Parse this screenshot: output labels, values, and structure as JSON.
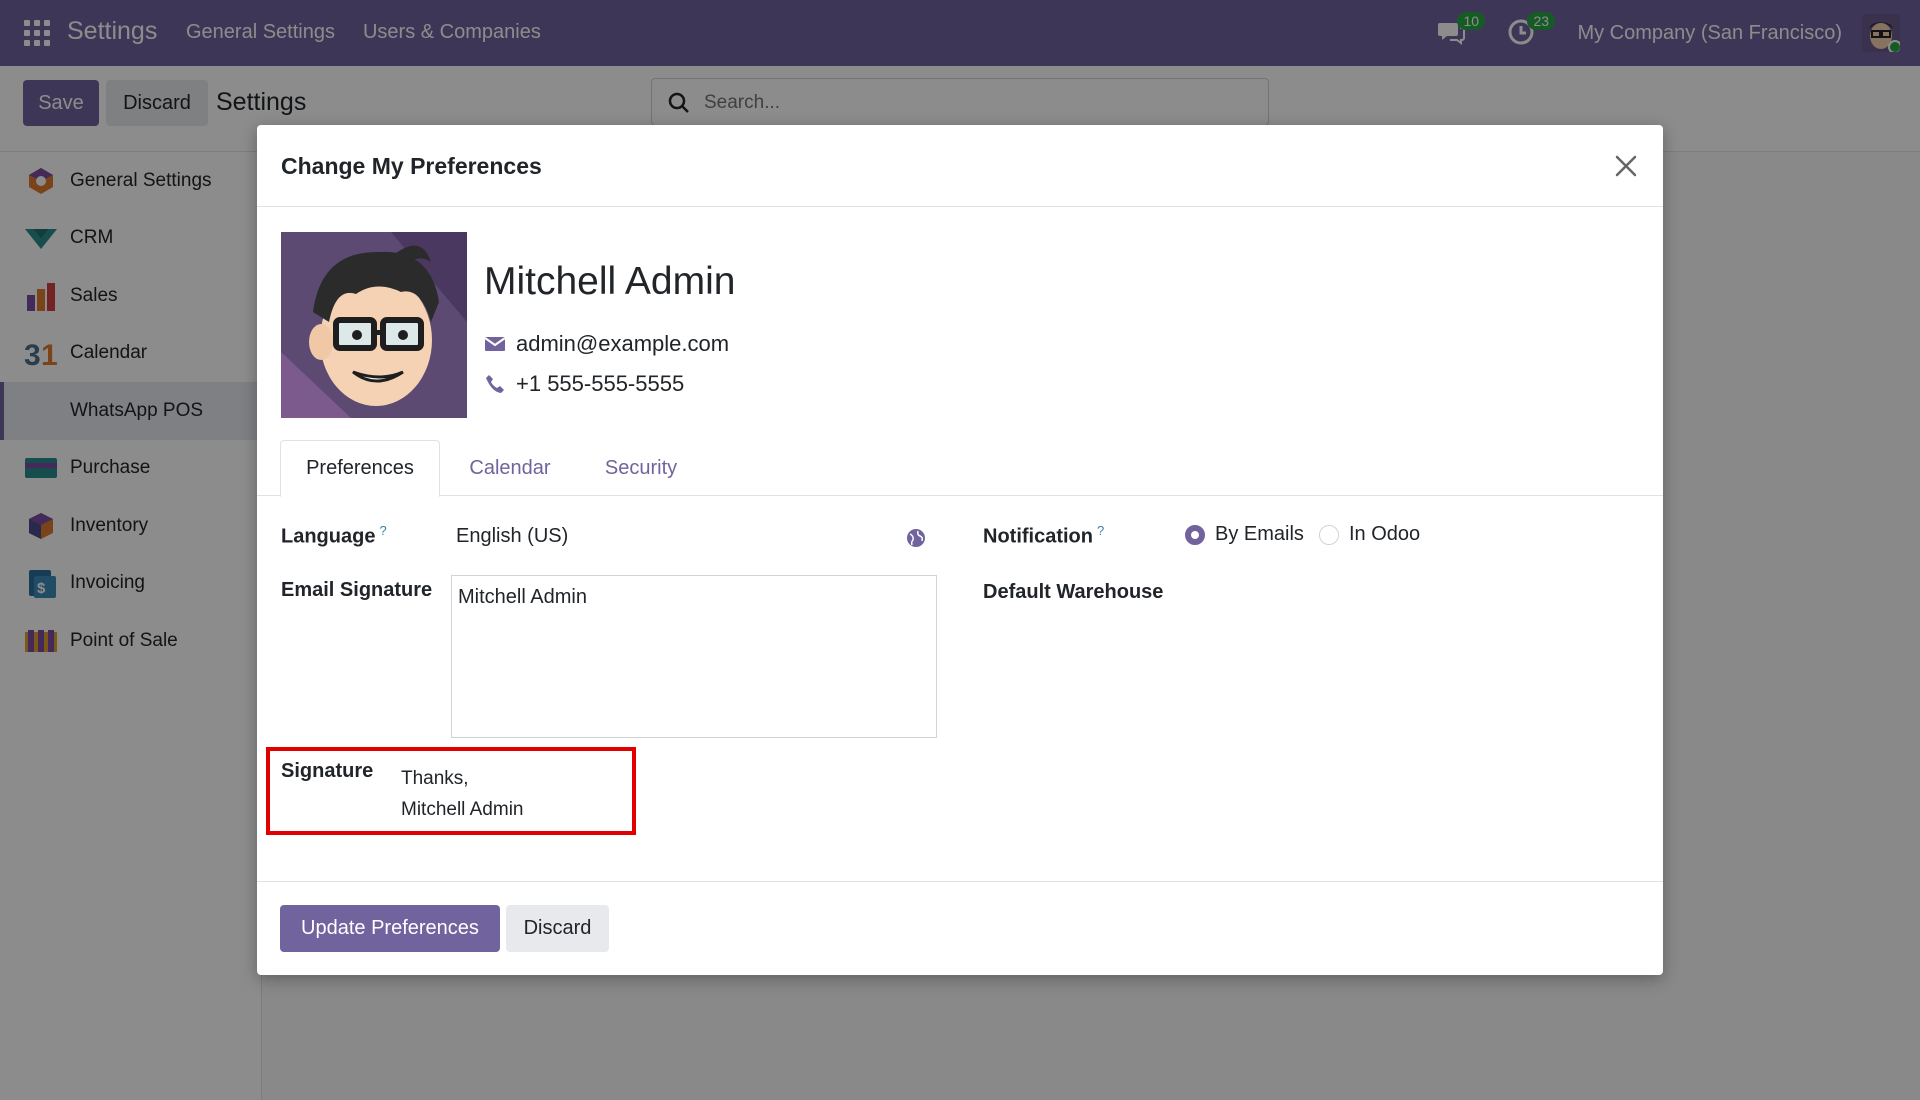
{
  "navbar": {
    "brand": "Settings",
    "menu": [
      "General Settings",
      "Users & Companies"
    ],
    "messages_count": "10",
    "activities_count": "23",
    "company": "My Company (San Francisco)"
  },
  "control": {
    "save_label": "Save",
    "discard_label": "Discard",
    "title": "Settings",
    "search_placeholder": "Search..."
  },
  "sidebar": {
    "items": [
      {
        "label": "General Settings",
        "icon": "general-settings-icon"
      },
      {
        "label": "CRM",
        "icon": "crm-icon"
      },
      {
        "label": "Sales",
        "icon": "sales-icon"
      },
      {
        "label": "Calendar",
        "icon": "calendar-icon"
      },
      {
        "label": "WhatsApp POS",
        "icon": "whatsapp-icon",
        "active": true
      },
      {
        "label": "Purchase",
        "icon": "purchase-icon"
      },
      {
        "label": "Inventory",
        "icon": "inventory-icon"
      },
      {
        "label": "Invoicing",
        "icon": "invoicing-icon"
      },
      {
        "label": "Point of Sale",
        "icon": "pos-icon"
      }
    ]
  },
  "modal": {
    "title": "Change My Preferences",
    "user": {
      "name": "Mitchell Admin",
      "email": "admin@example.com",
      "phone": "+1 555-555-5555"
    },
    "tabs": [
      "Preferences",
      "Calendar",
      "Security"
    ],
    "fields": {
      "language_label": "Language",
      "language_help": "?",
      "language_value": "English (US)",
      "email_signature_label": "Email Signature",
      "email_signature_value": "Mitchell Admin",
      "notification_label": "Notification",
      "notification_help": "?",
      "notification_options": [
        "By Emails",
        "In Odoo"
      ],
      "notification_selected": "By Emails",
      "default_warehouse_label": "Default Warehouse",
      "signature_label": "Signature",
      "signature_line1": "Thanks,",
      "signature_line2": "Mitchell Admin"
    },
    "footer": {
      "update_label": "Update Preferences",
      "discard_label": "Discard"
    }
  },
  "colors": {
    "primary": "#71639e",
    "highlight": "#e00000"
  }
}
